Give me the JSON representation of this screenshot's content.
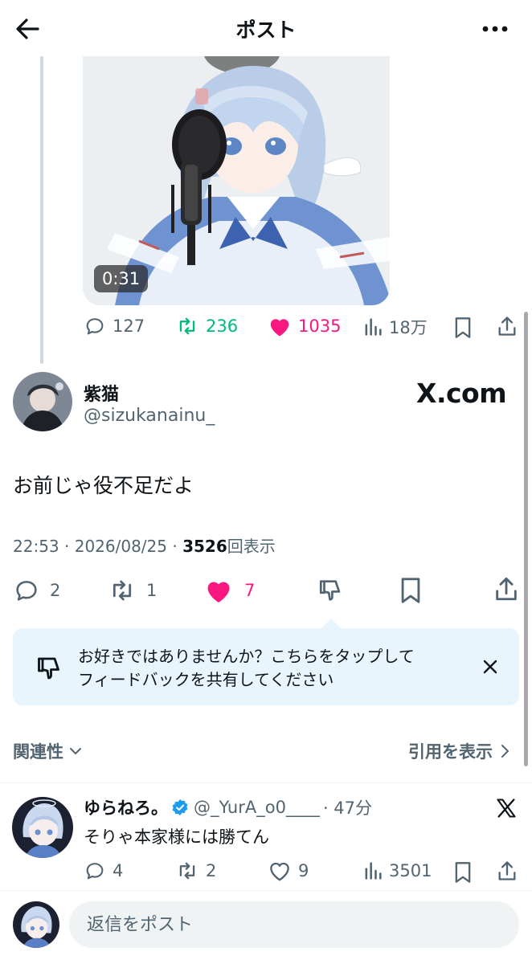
{
  "header": {
    "title": "ポスト"
  },
  "media": {
    "duration": "0:31"
  },
  "prev_post": {
    "stats": {
      "replies": "127",
      "reposts": "236",
      "likes": "1035",
      "views": "18万"
    }
  },
  "main_post": {
    "name": "紫猫",
    "handle": "@sizukanainu_",
    "source_logo": "X.com",
    "text": "お前じゃ役不足だよ",
    "time": "22:53",
    "date": "2026/08/25",
    "views_count": "3526",
    "views_label": "回表示",
    "stats": {
      "replies": "2",
      "reposts": "1",
      "likes": "7"
    }
  },
  "feedback": {
    "line1": "お好きではありませんか？こちらをタップして",
    "line2": "フィードバックを共有してください"
  },
  "sort": {
    "label": "関連性",
    "quotes_label": "引用を表示"
  },
  "reply": {
    "name": "ゆらねろ。",
    "handle": "@_YurA_o0____",
    "time": "· 47分",
    "text": "そりゃ本家様には勝てん",
    "stats": {
      "replies": "4",
      "reposts": "2",
      "likes": "9",
      "views": "3501"
    }
  },
  "compose": {
    "placeholder": "返信をポスト"
  },
  "colors": {
    "like": "#f91880",
    "repost": "#00ba7c",
    "verified": "#1d9bf0",
    "text_secondary": "#536471"
  }
}
